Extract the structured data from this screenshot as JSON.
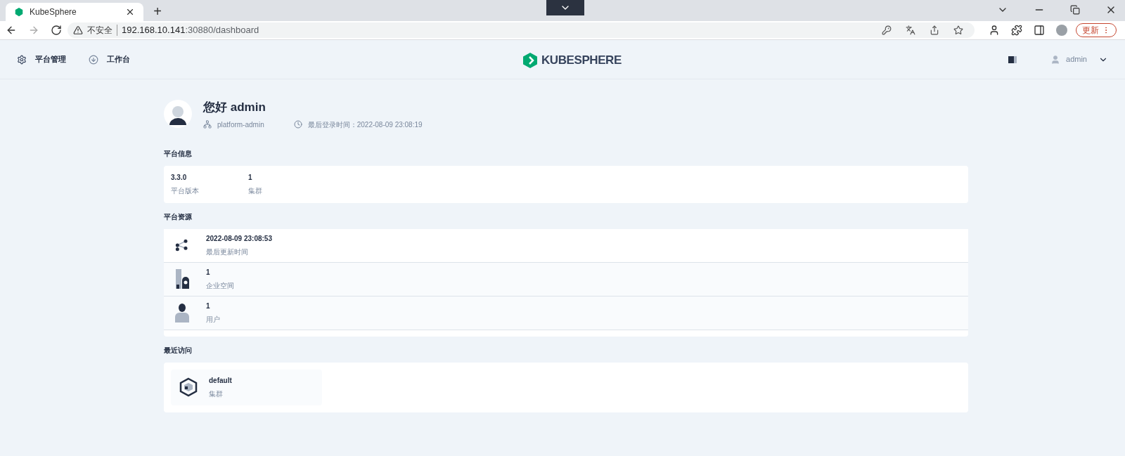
{
  "browser": {
    "tab_title": "KubeSphere",
    "new_tab": "+",
    "security": "不安全",
    "url_host": "192.168.10.141",
    "url_path": ":30880/dashboard",
    "update_button": "更新"
  },
  "nav": {
    "items": [
      {
        "label": "平台管理",
        "kind": "gear"
      },
      {
        "label": "工作台",
        "kind": "bench"
      }
    ],
    "logo": "KUBESPHERE",
    "user": "admin"
  },
  "greeting": {
    "title": "您好 admin",
    "role": "platform-admin",
    "last_login": "最后登录时间：2022-08-09 23:08:19"
  },
  "platform_info": {
    "heading": "平台信息",
    "items": [
      {
        "value": "3.3.0",
        "label": "平台版本"
      },
      {
        "value": "1",
        "label": "集群"
      }
    ]
  },
  "platform_resources": {
    "heading": "平台资源",
    "rows": [
      {
        "kind": "update",
        "value": "2022-08-09 23:08:53",
        "label": "最后更新时间"
      },
      {
        "kind": "workspace",
        "value": "1",
        "label": "企业空间"
      },
      {
        "kind": "user",
        "value": "1",
        "label": "用户"
      }
    ]
  },
  "recent": {
    "heading": "最近访问",
    "items": [
      {
        "name": "default",
        "type": "集群"
      }
    ]
  }
}
